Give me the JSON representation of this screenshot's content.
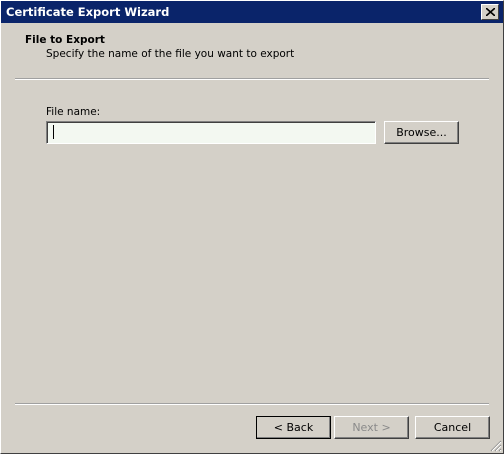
{
  "window": {
    "title": "Certificate Export Wizard"
  },
  "header": {
    "title": "File to Export",
    "subtitle": "Specify the name of the file you want to export"
  },
  "file": {
    "label": "File name:",
    "value": "",
    "browse_label": "Browse..."
  },
  "nav": {
    "back_label": "< Back",
    "next_label": "Next >",
    "cancel_label": "Cancel"
  },
  "icons": {
    "close": "close-icon",
    "grip": "resize-grip-icon"
  },
  "colors": {
    "titlebar": "#0a246a",
    "face": "#d4d0c8",
    "input_bg": "#f3f8f1",
    "disabled_text": "#8a8a8a"
  }
}
